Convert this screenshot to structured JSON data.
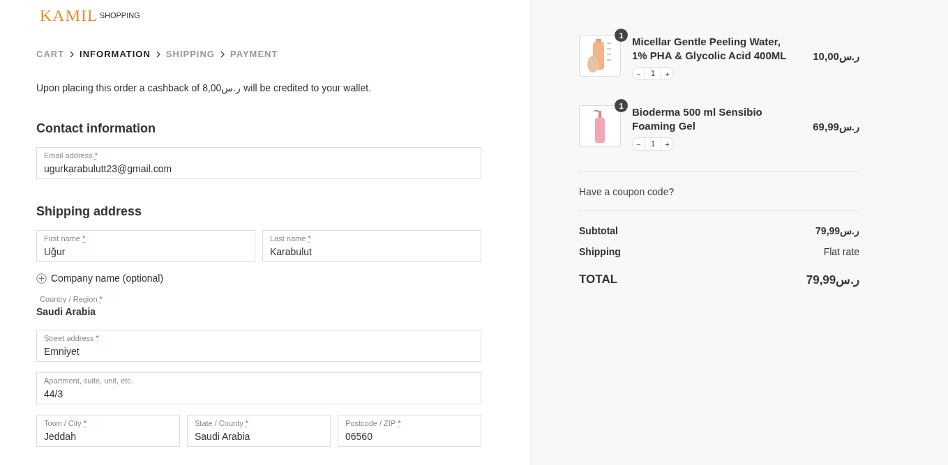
{
  "logo": {
    "brand": "KAMIL",
    "tagline": "SHOPPING"
  },
  "breadcrumb": [
    {
      "label": "CART",
      "selected": false
    },
    {
      "label": "INFORMATION",
      "selected": true
    },
    {
      "label": "SHIPPING",
      "selected": false
    },
    {
      "label": "PAYMENT",
      "selected": false
    }
  ],
  "required_mark": "*",
  "cashback_notice": "Upon placing this order a cashback of 8,00ر.س will be credited to your wallet.",
  "contact": {
    "heading": "Contact information",
    "rows": [
      [
        {
          "label": "Email address",
          "required": true,
          "value": "ugurkarabulutt23@gmail.com"
        }
      ]
    ]
  },
  "shipping": {
    "heading": "Shipping address",
    "rows_before": [
      [
        {
          "label": "First name",
          "required": true,
          "value": "Uğur"
        },
        {
          "label": "Last name",
          "required": true,
          "value": "Karabulut"
        }
      ]
    ],
    "company_link": "Company name (optional)",
    "country": {
      "label": "Country / Region",
      "required": true,
      "value": "Saudi Arabia"
    },
    "rows_after": [
      [
        {
          "label": "Street address",
          "required": true,
          "value": "Emniyet"
        }
      ],
      [
        {
          "label": "Apartment, suite, unit, etc.",
          "required": false,
          "value": "44/3"
        }
      ],
      [
        {
          "label": "Town / City",
          "required": true,
          "value": "Jeddah"
        },
        {
          "label": "State / County",
          "required": true,
          "value": "Saudi Arabia"
        },
        {
          "label": "Postcode / ZIP",
          "required": true,
          "value": "06560"
        }
      ]
    ]
  },
  "order": {
    "items": [
      {
        "name": "Micellar Gentle Peeling Water, 1% PHA & Glycolic Acid 400ML",
        "count": "1",
        "qty": "1",
        "minus": "−",
        "plus": "+",
        "price": "10,00ر.س",
        "kind": "bottle"
      },
      {
        "name": "Bioderma 500 ml Sensibio Foaming Gel",
        "count": "1",
        "qty": "1",
        "minus": "−",
        "plus": "+",
        "price": "69,99ر.س",
        "kind": "pump"
      }
    ],
    "coupon": "Have a coupon code?",
    "subtotal": {
      "label": "Subtotal",
      "value": "79,99ر.س"
    },
    "shipping": {
      "label": "Shipping",
      "value": "Flat rate"
    },
    "total": {
      "label": "TOTAL",
      "value": "79,99ر.س"
    }
  }
}
